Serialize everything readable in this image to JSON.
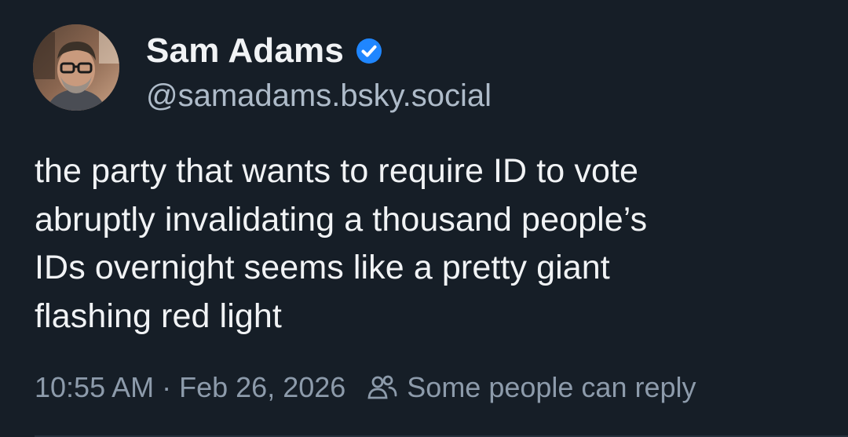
{
  "post": {
    "author": {
      "display_name": "Sam Adams",
      "handle": "@samadams.bsky.social",
      "verified": true,
      "verified_icon": "verified-check-icon",
      "avatar_icon": "avatar-photo"
    },
    "text_lines": [
      "the party that wants to require ID to vote",
      "abruptly invalidating a thousand people’s",
      "IDs overnight seems like a pretty giant",
      "flashing red light"
    ],
    "time": "10:55 AM",
    "separator": "·",
    "date": "Feb 26, 2026",
    "reply_icon": "people-icon",
    "reply_setting": "Some people can reply"
  },
  "colors": {
    "background": "#161e27",
    "text": "#f1f3f5",
    "handle": "#aebbc9",
    "meta": "#8d9bab",
    "verified": "#1f86ff"
  }
}
